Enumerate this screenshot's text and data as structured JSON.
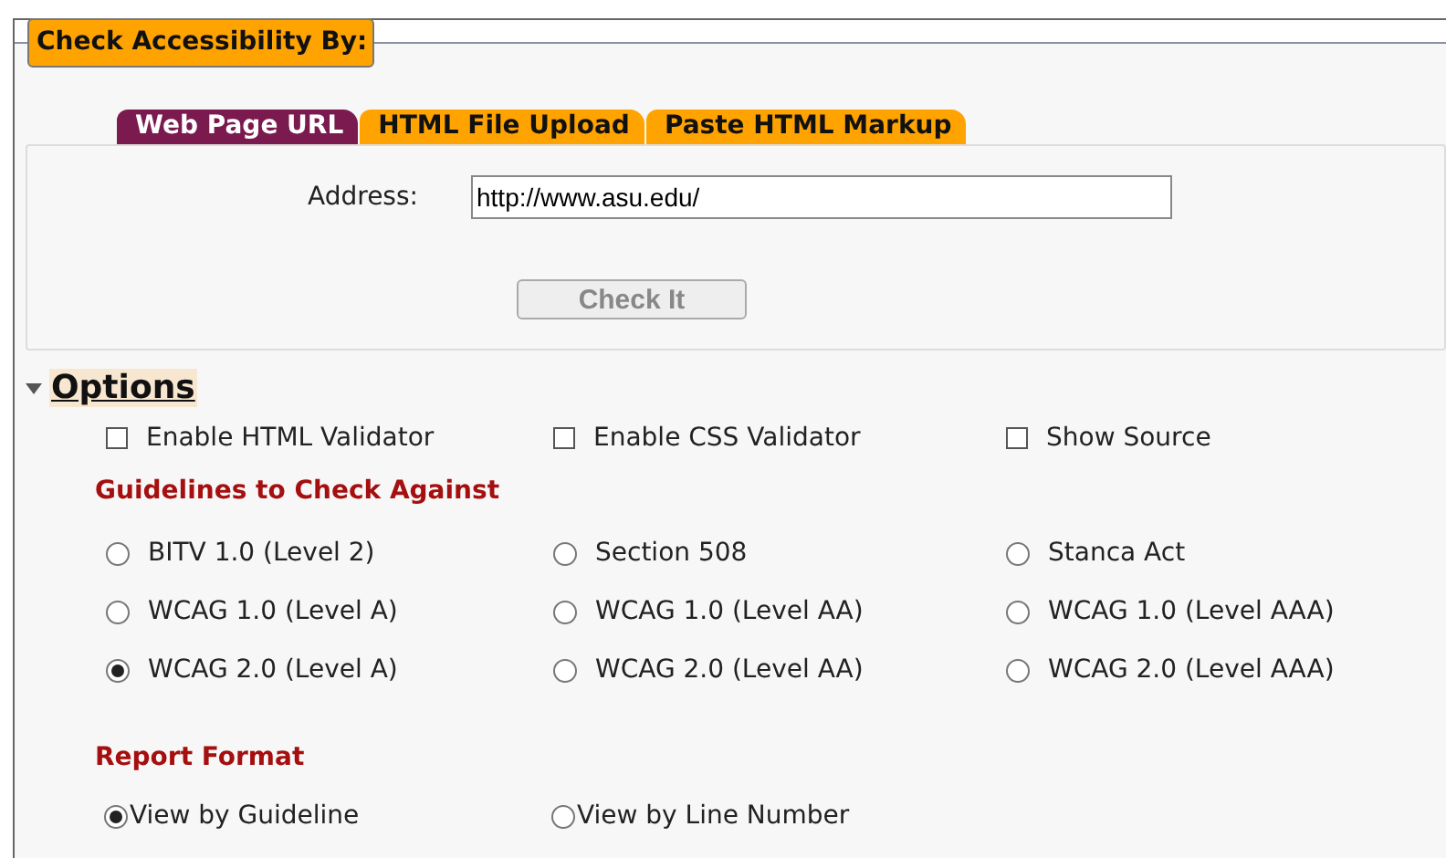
{
  "legend": "Check Accessibility By:",
  "tabs": [
    {
      "label": "Web Page URL",
      "selected": true
    },
    {
      "label": "HTML File Upload",
      "selected": false
    },
    {
      "label": "Paste HTML Markup",
      "selected": false
    }
  ],
  "address": {
    "label": "Address:",
    "value": "http://www.asu.edu/"
  },
  "check_button": {
    "label": "Check It",
    "disabled": true
  },
  "options": {
    "title": "Options",
    "expanded": true,
    "checkboxes": [
      {
        "label": "Enable HTML Validator",
        "checked": false
      },
      {
        "label": "Enable CSS Validator",
        "checked": false
      },
      {
        "label": "Show Source",
        "checked": false
      }
    ],
    "guidelines_heading": "Guidelines to Check Against",
    "guidelines": [
      {
        "label": "BITV 1.0 (Level 2)",
        "selected": false
      },
      {
        "label": "Section 508",
        "selected": false
      },
      {
        "label": "Stanca Act",
        "selected": false
      },
      {
        "label": "WCAG 1.0 (Level A)",
        "selected": false
      },
      {
        "label": "WCAG 1.0 (Level AA)",
        "selected": false
      },
      {
        "label": "WCAG 1.0 (Level AAA)",
        "selected": false
      },
      {
        "label": "WCAG 2.0 (Level A)",
        "selected": true
      },
      {
        "label": "WCAG 2.0 (Level AA)",
        "selected": false
      },
      {
        "label": "WCAG 2.0 (Level AAA)",
        "selected": false
      }
    ],
    "report_heading": "Report Format",
    "report_formats": [
      {
        "label": "View by Guideline",
        "selected": true
      },
      {
        "label": "View by Line Number",
        "selected": false
      }
    ]
  }
}
